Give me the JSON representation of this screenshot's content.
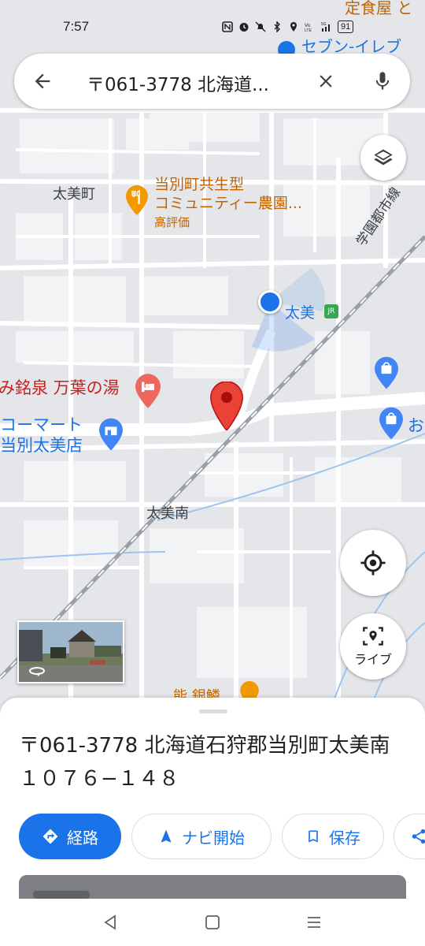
{
  "status_bar": {
    "time": "7:57",
    "battery": "91"
  },
  "search": {
    "query": "〒061-3778 北海道...",
    "back_icon": "arrow-back-icon",
    "clear_icon": "close-icon",
    "mic_icon": "mic-icon"
  },
  "map": {
    "labels": {
      "top_right_poi_1": "定食屋 と",
      "top_right_poi_2": "セブン-イレブ",
      "town_taibi": "太美町",
      "farm_line1": "当別町共生型",
      "farm_line2": "コミュニティー農園...",
      "farm_rating": "高評価",
      "rail_line": "学園都市線",
      "station": "太美",
      "onsen": "み銘泉 万葉の湯",
      "store_line1": "コーマート",
      "store_line2": "当別太美店",
      "area_south": "太美南",
      "partial_poi_right": "お",
      "bottom_poi": "能 銀鱗"
    },
    "colors": {
      "background": "#e4e6e9",
      "block": "#f1f3f4",
      "road": "#ffffff",
      "water": "#9ec5f0",
      "rail": "#9aa0a6",
      "accent_blue": "#1a73e8",
      "food_orange": "#f29900",
      "pin_red": "#ea4335"
    },
    "street_view_icon": "rotate-360-icon",
    "layers_icon": "layers-icon",
    "my_location_icon": "crosshair-icon",
    "live_label": "ライブ",
    "live_icon": "live-view-icon"
  },
  "sheet": {
    "address": "〒061-3778 北海道石狩郡当別町太美南１０７６−１４８",
    "actions": [
      {
        "label": "経路",
        "icon": "directions-icon"
      },
      {
        "label": "ナビ開始",
        "icon": "navigation-icon"
      },
      {
        "label": "保存",
        "icon": "bookmark-icon"
      },
      {
        "label": "",
        "icon": "share-icon"
      }
    ]
  },
  "nav_bar": {
    "back_icon": "triangle-back-icon",
    "home_icon": "square-home-icon",
    "recents_icon": "menu-lines-icon"
  }
}
